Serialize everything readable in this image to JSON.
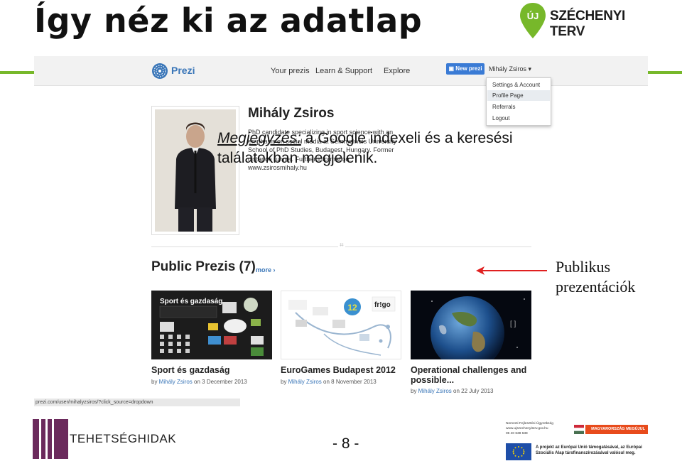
{
  "slide": {
    "title": "Így néz ki az adatlap",
    "page_number": "- 8 -",
    "side_label_line1": "Publikus",
    "side_label_line2": "prezentációk",
    "note_label": "Megjegyzés:",
    "note_text": " a Google indexeli és a keresési találatokban megjelenik."
  },
  "szechenyi_logo": {
    "pin_text": "ÚJ",
    "text": "SZÉCHENYI",
    "text2": "TERV"
  },
  "prezi": {
    "brand": "Prezi",
    "nav": [
      "Your prezis",
      "Learn & Support",
      "Explore"
    ],
    "new_prezi_button": "New prezi",
    "user_menu": "Mihály Zsiros ▾",
    "dropdown": [
      "Settings & Account",
      "Profile Page",
      "Referrals",
      "Logout"
    ],
    "profile": {
      "name": "Mihály Zsiros",
      "bio": "PhD candidate specializing in sport science with an emphasis on social media at Semmelweis University School of PhD Studies, Budapest, Hungary. Former distance runner. Further information: www.zsirosmihaly.hu"
    },
    "divider_mark": "⌗",
    "public_title": "Public Prezis (7)",
    "more_link": "more ›",
    "prezis": [
      {
        "title": "Sport és gazdaság",
        "by": "by ",
        "author": "Mihály Zsiros",
        "date": " on 3 December 2013",
        "thumb_title": "Sport és gazdaság"
      },
      {
        "title": "EuroGames Budapest 2012",
        "by": "by ",
        "author": "Mihály Zsiros",
        "date": " on 8 November 2013",
        "thumb_badge": "fr!go"
      },
      {
        "title": "Operational challenges and possible...",
        "by": "by ",
        "author": "Mihály Zsiros",
        "date": " on 22 July 2013"
      }
    ],
    "status_url": "prezi.com/user/mihalyzsiros/?click_source=dropdown"
  },
  "footer": {
    "tehets_text": "TEHETSÉGHIDAK",
    "eu_small_lines": [
      "Nemzeti Fejlesztési Ügynökség",
      "www.ujszechenyiterv.gov.hu",
      "06 40 638 638"
    ],
    "eu_bar": "MAGYARORSZÁG MEGÚJUL",
    "eu_text": "A projekt az Európai Unió támogatásával, az Európai Szociális Alap társfinanszírozásával valósul meg."
  },
  "colors": {
    "green": "#77b82a",
    "prezi_blue": "#3a76b8",
    "tehets_purple": "#6b2a5c",
    "arrow_red": "#e02020"
  }
}
